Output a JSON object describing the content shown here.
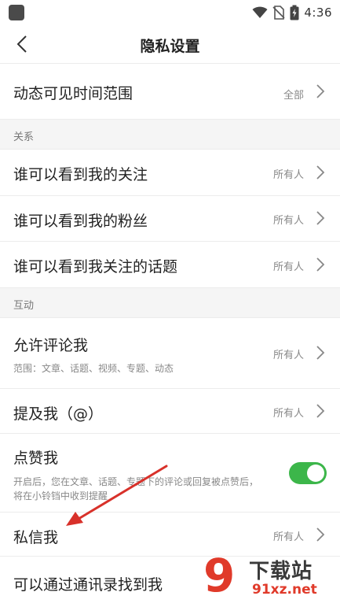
{
  "status_bar": {
    "time": "4:36",
    "icons": [
      "app-icon",
      "wifi-icon",
      "no-sim-icon",
      "battery-icon"
    ]
  },
  "header": {
    "title": "隐私设置",
    "back_icon": "chevron-left-icon"
  },
  "rows": {
    "visible_time": {
      "title": "动态可见时间范围",
      "value": "全部"
    },
    "follows": {
      "title": "谁可以看到我的关注",
      "value": "所有人"
    },
    "fans": {
      "title": "谁可以看到我的粉丝",
      "value": "所有人"
    },
    "topics": {
      "title": "谁可以看到我关注的话题",
      "value": "所有人"
    },
    "comment": {
      "title": "允许评论我",
      "subtitle": "范围：文章、话题、视频、专题、动态",
      "value": "所有人"
    },
    "mention": {
      "title": "提及我（@）",
      "value": "所有人"
    },
    "like": {
      "title": "点赞我",
      "subtitle": "开启后，您在文章、话题、专题下的评论或回复被点赞后，将在小铃铛中收到提醒",
      "toggle_on": true
    },
    "message": {
      "title": "私信我",
      "value": "所有人"
    },
    "contacts": {
      "title": "可以通过通讯录找到我"
    }
  },
  "sections": {
    "relations": "关系",
    "interaction": "互动"
  },
  "watermark": {
    "logo": "9",
    "name": "下载站",
    "domain": "91xz.net"
  },
  "colors": {
    "toggle_on": "#3cb64a",
    "annotation_arrow": "#d8312a",
    "watermark_red": "#e03a2a"
  }
}
